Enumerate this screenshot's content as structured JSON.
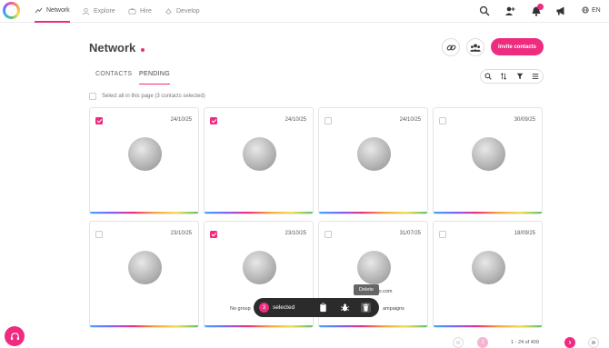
{
  "nav": {
    "items": [
      {
        "label": "Network",
        "icon": "network-icon",
        "active": true
      },
      {
        "label": "Explore",
        "icon": "explore-icon",
        "active": false
      },
      {
        "label": "Hire",
        "icon": "hire-icon",
        "active": false
      },
      {
        "label": "Develop",
        "icon": "develop-icon",
        "active": false
      }
    ],
    "lang": "EN"
  },
  "page": {
    "title": "Network",
    "invite_label": "Invite contacts"
  },
  "tabs": [
    {
      "label": "CONTACTS",
      "active": false
    },
    {
      "label": "PENDING",
      "active": true
    }
  ],
  "select_all_label": "Select all in this page (3 contacts selected)",
  "cards": [
    {
      "date": "24/10/25",
      "checked": true
    },
    {
      "date": "24/10/25",
      "checked": true
    },
    {
      "date": "24/10/25",
      "checked": false
    },
    {
      "date": "30/09/25",
      "checked": false
    },
    {
      "date": "23/10/25",
      "checked": false
    },
    {
      "date": "23/10/25",
      "checked": true,
      "caption": "No group"
    },
    {
      "date": "31/07/25",
      "checked": false,
      "caption_top": "sso.com",
      "caption": "ampaigns"
    },
    {
      "date": "18/09/25",
      "checked": false
    }
  ],
  "action_bar": {
    "count": "3",
    "label": "selected",
    "tooltip": "Delete"
  },
  "pagination": {
    "range_text": "1 - 24 of 409",
    "current_page": "1"
  },
  "colors": {
    "accent": "#ee2b7f",
    "action_bar_bg": "#2b2b2b"
  }
}
